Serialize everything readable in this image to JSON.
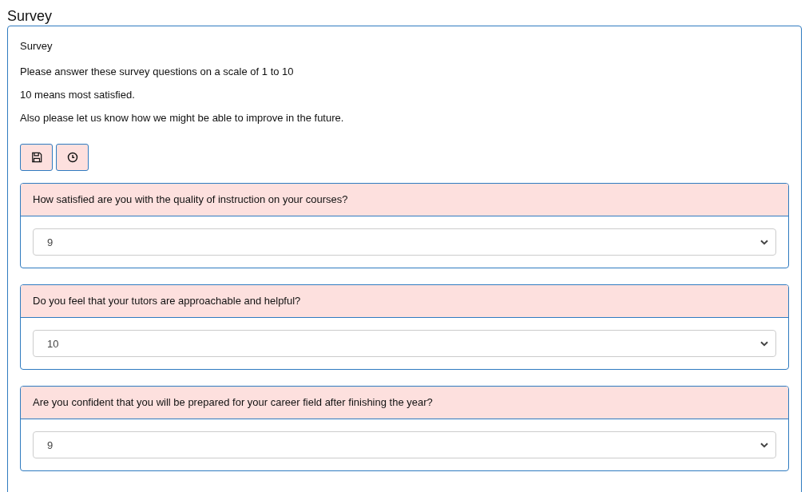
{
  "page_title": "Survey",
  "card": {
    "title": "Survey",
    "paragraphs": [
      "Please answer these survey questions on a scale of 1 to 10",
      "10 means most satisfied.",
      "Also please let us know how we might be able to improve in the future."
    ],
    "buttons": [
      {
        "kind": "save"
      },
      {
        "kind": "clock"
      }
    ],
    "questions": [
      {
        "question": "How satisfied are you with the quality of instruction on your courses?",
        "answer": "9"
      },
      {
        "question": "Do you feel that your tutors are approachable and helpful?",
        "answer": "10"
      },
      {
        "question": "Are you confident that you will be prepared for your career field after finishing the year?",
        "answer": "9"
      }
    ]
  }
}
